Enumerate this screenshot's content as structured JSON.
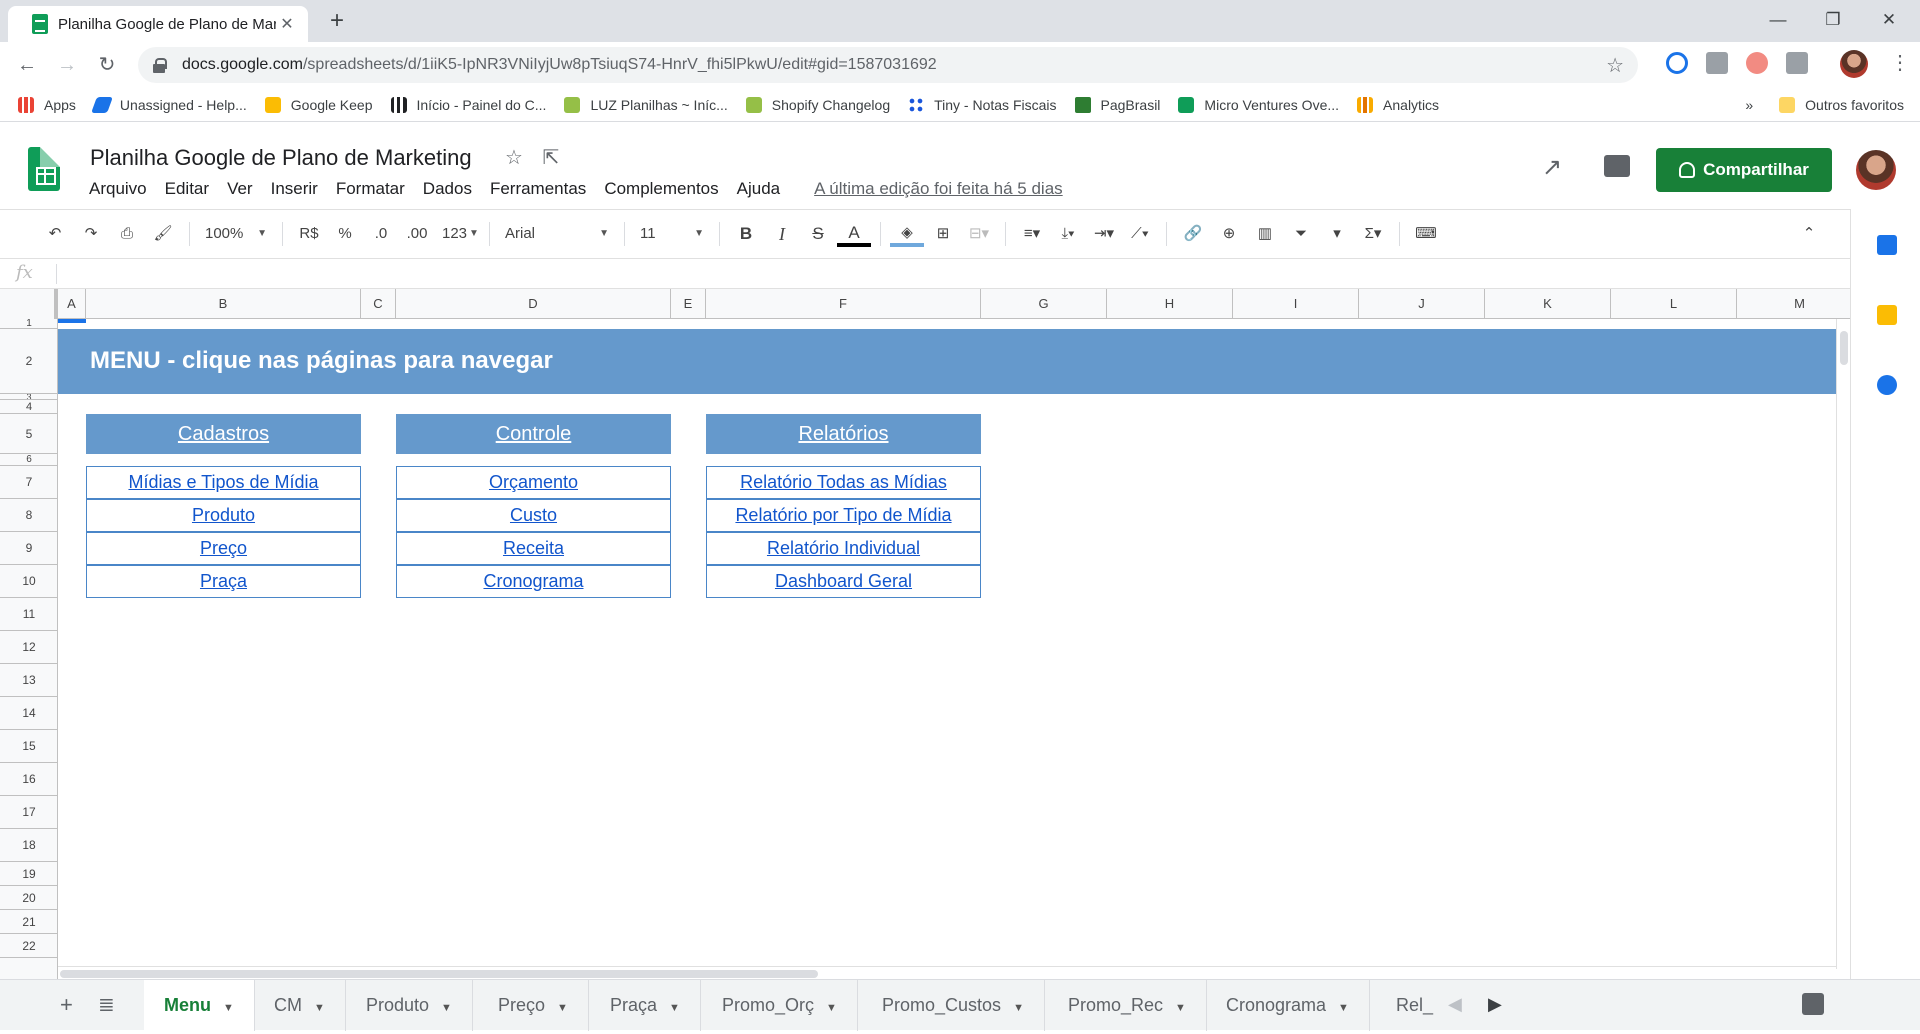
{
  "browser": {
    "tab_title": "Planilha Google de Plano de Mar",
    "url_host": "docs.google.com",
    "url_path": "/spreadsheets/d/1iiK5-IpNR3VNiIyjUw8pTsiuqS74-HnrV_fhi5lPkwU/edit#gid=1587031692"
  },
  "bookmarks": [
    {
      "label": "Apps",
      "icon": "apps-grid-icon",
      "color": "#ea4335"
    },
    {
      "label": "Unassigned - Help...",
      "icon": "zendesk-icon",
      "color": "#1a73e8"
    },
    {
      "label": "Google Keep",
      "icon": "keep-icon",
      "color": "#fbbc04"
    },
    {
      "label": "Início - Painel do C...",
      "icon": "chart-icon",
      "color": "#202124"
    },
    {
      "label": "LUZ Planilhas ~ Iníc...",
      "icon": "shopify-icon",
      "color": "#95bf47"
    },
    {
      "label": "Shopify Changelog",
      "icon": "shopify-icon",
      "color": "#95bf47"
    },
    {
      "label": "Tiny - Notas Fiscais",
      "icon": "tiny-icon",
      "color": "#1a56db"
    },
    {
      "label": "PagBrasil",
      "icon": "pagbrasil-icon",
      "color": "#2e7d32"
    },
    {
      "label": "Micro Ventures Ove...",
      "icon": "sheets-icon",
      "color": "#0f9d58"
    },
    {
      "label": "Analytics",
      "icon": "analytics-icon",
      "color": "#f9ab00"
    }
  ],
  "bookmarks_more": "»",
  "bookmarks_folder": "Outros favoritos",
  "doc": {
    "title": "Planilha Google de Plano de Marketing",
    "menus": [
      "Arquivo",
      "Editar",
      "Ver",
      "Inserir",
      "Formatar",
      "Dados",
      "Ferramentas",
      "Complementos",
      "Ajuda"
    ],
    "last_edit": "A última edição foi feita há 5 dias",
    "share_label": "Compartilhar"
  },
  "toolbar": {
    "zoom": "100%",
    "currency": "R$",
    "percent": "%",
    "dec_less": ".0",
    "dec_more": ".00",
    "format_more": "123",
    "font": "Arial",
    "font_size": "11"
  },
  "columns": [
    "A",
    "B",
    "C",
    "D",
    "E",
    "F",
    "G",
    "H",
    "I",
    "J",
    "K",
    "L",
    "M"
  ],
  "rows": [
    "1",
    "2",
    "3",
    "4",
    "5",
    "6",
    "7",
    "8",
    "9",
    "10",
    "11",
    "12",
    "13",
    "14",
    "15",
    "16",
    "17",
    "18",
    "19",
    "20",
    "21",
    "22"
  ],
  "sheet": {
    "banner": "MENU - clique nas páginas para navegar",
    "sections": [
      {
        "title": "Cadastros",
        "links": [
          "Mídias e Tipos de Mídia",
          "Produto",
          "Preço",
          "Praça"
        ]
      },
      {
        "title": "Controle",
        "links": [
          "Orçamento",
          "Custo",
          "Receita",
          "Cronograma"
        ]
      },
      {
        "title": "Relatórios",
        "links": [
          "Relatório Todas as Mídias",
          "Relatório por Tipo de Mídia",
          "Relatório Individual",
          "Dashboard Geral"
        ]
      }
    ],
    "colors": {
      "header_blue": "#6599cc",
      "link": "#1155cc",
      "link_border": "#4a86c8",
      "share_green": "#188038"
    }
  },
  "sheet_tabs": [
    "Menu",
    "CM",
    "Produto",
    "Preço",
    "Praça",
    "Promo_Orç",
    "Promo_Custos",
    "Promo_Rec",
    "Cronograma",
    "Rel_"
  ],
  "active_sheet": "Menu"
}
